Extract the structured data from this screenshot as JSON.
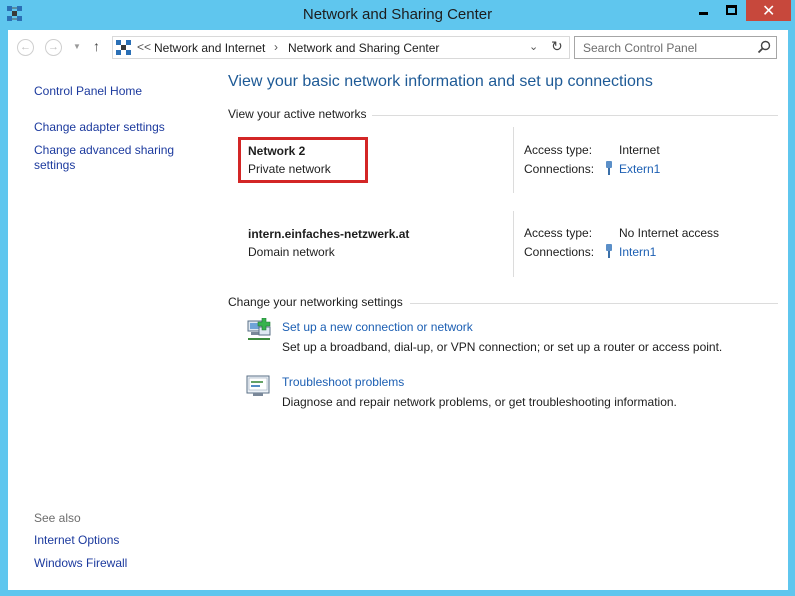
{
  "window": {
    "title": "Network and Sharing Center",
    "controls": {
      "minimize_icon": "minimize-icon",
      "maximize_icon": "maximize-icon",
      "close_icon": "close-icon"
    }
  },
  "navigation": {
    "breadcrumb_prefix": "<<",
    "breadcrumb": [
      "Network and Internet",
      "Network and Sharing Center"
    ],
    "search_placeholder": "Search Control Panel"
  },
  "sidebar": {
    "links": [
      "Control Panel Home",
      "Change adapter settings",
      "Change advanced sharing",
      "settings"
    ],
    "see_also_title": "See also",
    "see_also_links": [
      "Internet Options",
      "Windows Firewall"
    ]
  },
  "main": {
    "title": "View your basic network information and set up connections",
    "active_networks_heading": "View your active networks",
    "networks": [
      {
        "name": "Network  2",
        "category": "Private network",
        "access_label": "Access type:",
        "access_value": "Internet",
        "connections_label": "Connections:",
        "connection": "Extern1"
      },
      {
        "name": "intern.einfaches-netzwerk.at",
        "category": "Domain network",
        "access_label": "Access type:",
        "access_value": "No Internet access",
        "connections_label": "Connections:",
        "connection": "Intern1"
      }
    ],
    "settings_heading": "Change your networking settings",
    "tasks": [
      {
        "link": "Set up a new connection or network",
        "description": "Set up a broadband, dial-up, or VPN connection; or set up a router or access point."
      },
      {
        "link": "Troubleshoot problems",
        "description": "Diagnose and repair network problems, or get troubleshooting information."
      }
    ]
  },
  "colors": {
    "frame": "#5fc6ee",
    "link": "#1c5fb3",
    "title": "#1e5a96",
    "highlight": "#d32626",
    "close": "#c7483c"
  }
}
